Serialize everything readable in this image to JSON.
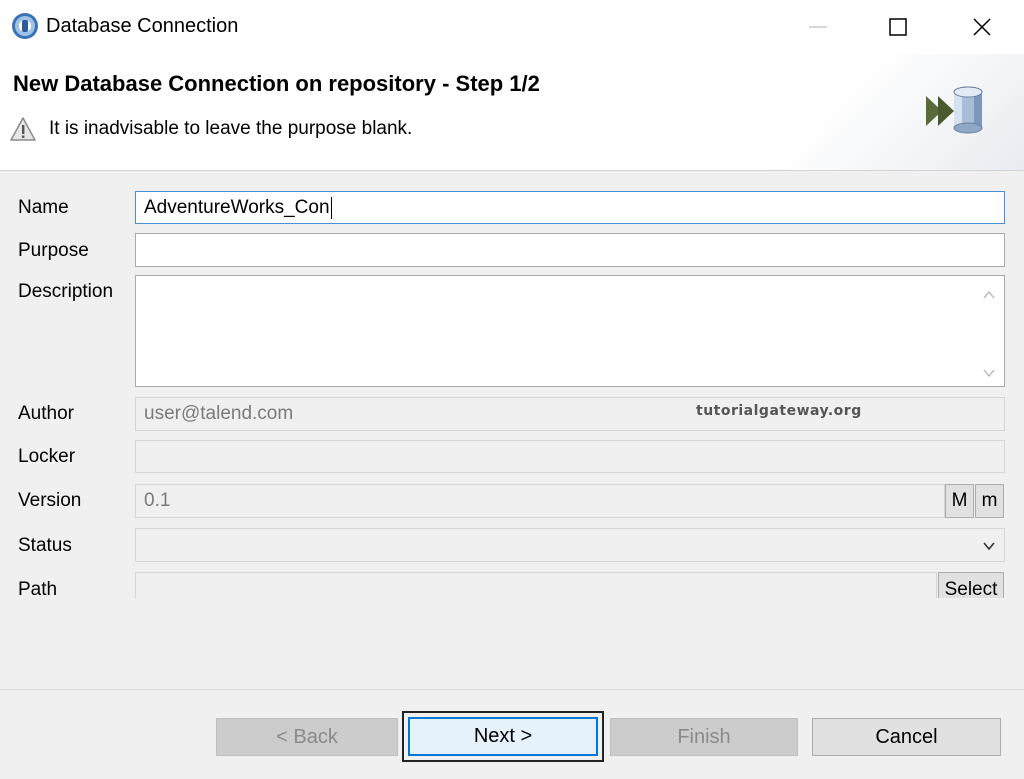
{
  "window": {
    "title": "Database Connection"
  },
  "banner": {
    "title": "New Database Connection on repository - Step 1/2",
    "message": "It is inadvisable to leave the purpose blank."
  },
  "form": {
    "name": {
      "label": "Name",
      "value": "AdventureWorks_Con"
    },
    "purpose": {
      "label": "Purpose",
      "value": ""
    },
    "description": {
      "label": "Description",
      "value": ""
    },
    "author": {
      "label": "Author",
      "value": "user@talend.com"
    },
    "locker": {
      "label": "Locker",
      "value": ""
    },
    "version": {
      "label": "Version",
      "value": "0.1",
      "major_label": "M",
      "minor_label": "m"
    },
    "status": {
      "label": "Status",
      "value": ""
    },
    "path": {
      "label": "Path",
      "value": "",
      "select_label": "Select"
    }
  },
  "watermark": "tutorialgateway.org",
  "buttons": {
    "back": "< Back",
    "next": "Next >",
    "finish": "Finish",
    "cancel": "Cancel"
  },
  "icons": {
    "app": "talend-app-icon",
    "warning": "warning-icon",
    "wizard": "database-wizard-icon"
  }
}
